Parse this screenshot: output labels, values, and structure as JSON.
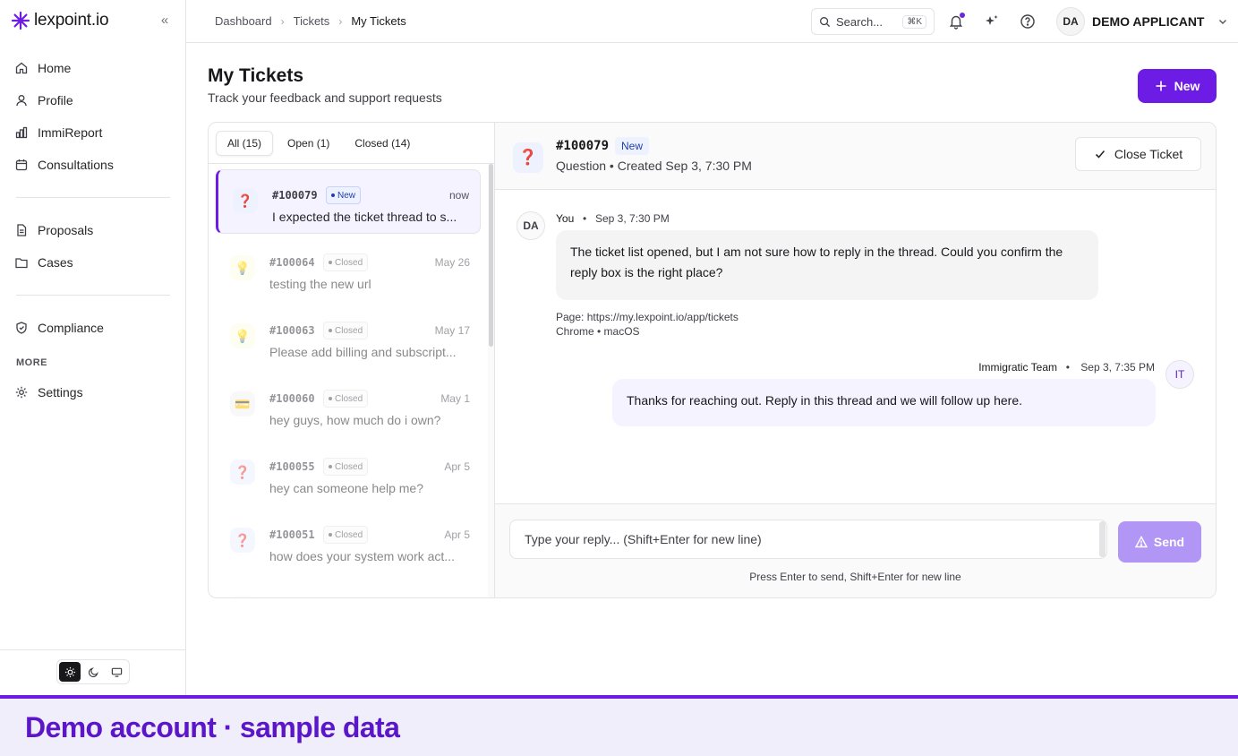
{
  "app": {
    "name": "lexpoint.io",
    "brand_color": "#6d1ce6"
  },
  "sidebar": {
    "collapse_icon": "double-chevron-left-icon",
    "group1": [
      {
        "label": "Home",
        "icon": "home-icon"
      },
      {
        "label": "Profile",
        "icon": "user-icon"
      },
      {
        "label": "ImmiReport",
        "icon": "chart-icon"
      },
      {
        "label": "Consultations",
        "icon": "calendar-icon"
      }
    ],
    "group2": [
      {
        "label": "Proposals",
        "icon": "document-icon"
      },
      {
        "label": "Cases",
        "icon": "folder-icon"
      }
    ],
    "group3": [
      {
        "label": "Compliance",
        "icon": "shield-icon"
      }
    ],
    "more_label": "MORE",
    "group4": [
      {
        "label": "Settings",
        "icon": "gear-icon"
      }
    ],
    "theme_options": [
      "light",
      "dark",
      "system"
    ],
    "theme_selected": "light"
  },
  "topbar": {
    "breadcrumb": [
      "Dashboard",
      "Tickets",
      "My Tickets"
    ],
    "search_placeholder": "Search...",
    "search_shortcut": "⌘K",
    "user_initials": "DA",
    "user_name": "DEMO APPLICANT"
  },
  "page": {
    "title": "My Tickets",
    "subtitle": "Track your feedback and support requests",
    "new_button": "New"
  },
  "tabs": [
    {
      "label": "All (15)",
      "active": true
    },
    {
      "label": "Open (1)",
      "active": false
    },
    {
      "label": "Closed (14)",
      "active": false
    }
  ],
  "tickets": [
    {
      "id": "#100079",
      "status": "New",
      "date": "now",
      "text": "I expected the ticket thread to s...",
      "icon": "question-icon",
      "glyph": "❓",
      "selected": true
    },
    {
      "id": "#100064",
      "status": "Closed",
      "date": "May 26",
      "text": "testing the new url",
      "icon": "lightbulb-icon",
      "glyph": "💡",
      "selected": false
    },
    {
      "id": "#100063",
      "status": "Closed",
      "date": "May 17",
      "text": "Please add billing and subscript...",
      "icon": "lightbulb-icon",
      "glyph": "💡",
      "selected": false
    },
    {
      "id": "#100060",
      "status": "Closed",
      "date": "May 1",
      "text": "hey guys, how much do i own?",
      "icon": "credit-card-icon",
      "glyph": "💳",
      "selected": false
    },
    {
      "id": "#100055",
      "status": "Closed",
      "date": "Apr 5",
      "text": "hey can someone help me?",
      "icon": "question-icon",
      "glyph": "❓",
      "selected": false
    },
    {
      "id": "#100051",
      "status": "Closed",
      "date": "Apr 5",
      "text": "how does your system work act...",
      "icon": "question-icon",
      "glyph": "❓",
      "selected": false
    }
  ],
  "detail": {
    "id": "#100079",
    "status": "New",
    "meta": "Question • Created Sep 3, 7:30 PM",
    "close_button": "Close Ticket",
    "messages": [
      {
        "avatar": "DA",
        "author": "You",
        "time": "Sep 3, 7:30 PM",
        "body": "The ticket list opened, but I am not sure how to reply in the thread. Could you confirm the reply box is the right place?",
        "page": "Page: https://my.lexpoint.io/app/tickets",
        "env": "Chrome • macOS"
      },
      {
        "avatar": "IT",
        "author": "Immigratic Team",
        "time": "Sep 3, 7:35 PM",
        "body": "Thanks for reaching out. Reply in this thread and we will follow up here."
      }
    ],
    "reply_placeholder": "Type your reply... (Shift+Enter for new line)",
    "send_button": "Send",
    "hint": "Press Enter to send, Shift+Enter for new line"
  },
  "banner": {
    "text": "Demo account · sample data"
  }
}
